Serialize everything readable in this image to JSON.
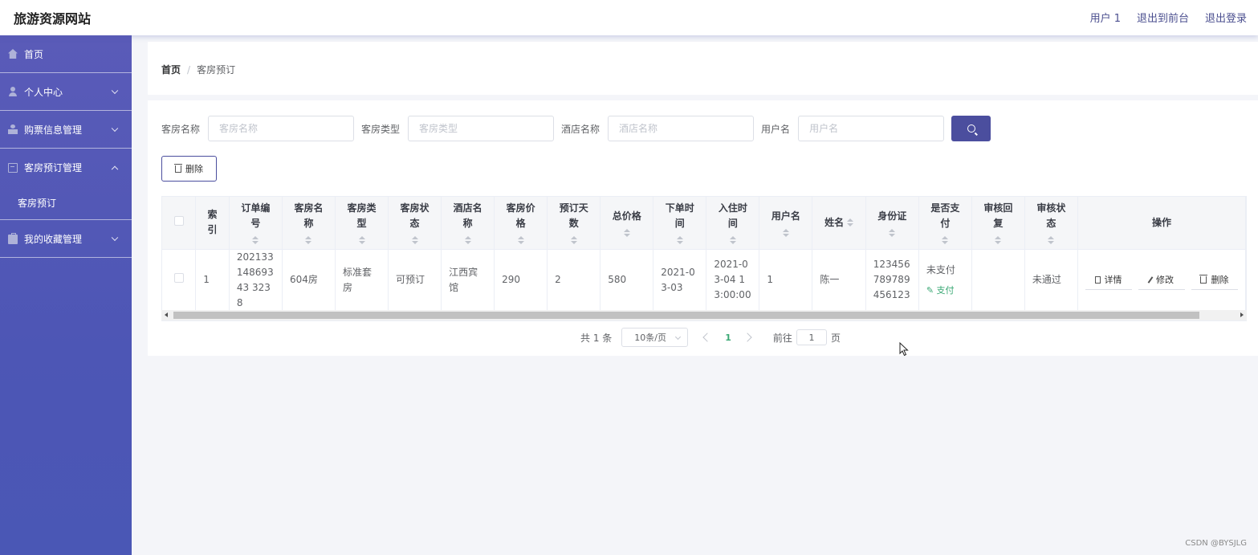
{
  "header": {
    "site_title": "旅游资源网站",
    "links": [
      "用户 1",
      "退出到前台",
      "退出登录"
    ]
  },
  "sidebar": {
    "items": [
      {
        "label": "首页",
        "icon": "home-icon",
        "expandable": false
      },
      {
        "label": "个人中心",
        "icon": "user-icon",
        "expandable": true,
        "expanded": false
      },
      {
        "label": "购票信息管理",
        "icon": "ticket-icon",
        "expandable": true,
        "expanded": false
      },
      {
        "label": "客房预订管理",
        "icon": "card-icon",
        "expandable": true,
        "expanded": true,
        "children": [
          "客房预订"
        ]
      },
      {
        "label": "我的收藏管理",
        "icon": "box-icon",
        "expandable": true,
        "expanded": false
      }
    ]
  },
  "breadcrumb": {
    "home": "首页",
    "separator": "/",
    "current": "客房预订"
  },
  "search": {
    "fields": [
      {
        "label": "客房名称",
        "placeholder": "客房名称",
        "value": ""
      },
      {
        "label": "客房类型",
        "placeholder": "客房类型",
        "value": ""
      },
      {
        "label": "酒店名称",
        "placeholder": "酒店名称",
        "value": ""
      },
      {
        "label": "用户名",
        "placeholder": "用户名",
        "value": ""
      }
    ],
    "button_icon": "search-icon"
  },
  "toolbar": {
    "delete_label": "删除"
  },
  "table": {
    "columns": [
      "索引",
      "订单编号",
      "客房名称",
      "客房类型",
      "客房状态",
      "酒店名称",
      "客房价格",
      "预订天数",
      "总价格",
      "下单时间",
      "入住时间",
      "用户名",
      "姓名",
      "身份证",
      "是否支付",
      "审核回复",
      "审核状态",
      "操作"
    ],
    "rows": [
      {
        "index": "1",
        "order_no": "20213314869343 3238",
        "room_name": "604房",
        "room_type": "标准套房",
        "room_status": "可预订",
        "hotel_name": "江西宾馆",
        "price": "290",
        "days": "2",
        "total": "580",
        "order_time": "2021-03-03",
        "checkin_time": "2021-03-04 13:00:00",
        "username": "1",
        "name": "陈一",
        "id_card": "123456789789456123",
        "paid": "未支付",
        "pay_action": "支付",
        "review_reply": "",
        "review_status": "未通过",
        "actions": [
          "详情",
          "修改",
          "删除"
        ]
      }
    ]
  },
  "pagination": {
    "total": "共 1 条",
    "page_size": "10条/页",
    "current_page": "1",
    "goto_label": "前往",
    "goto_value": "1",
    "page_suffix": "页"
  },
  "watermark": "CSDN @BYSJLG",
  "colors": {
    "primary": "#4b4e9e",
    "sidebar": "#5458b6",
    "success": "#3aa874"
  }
}
